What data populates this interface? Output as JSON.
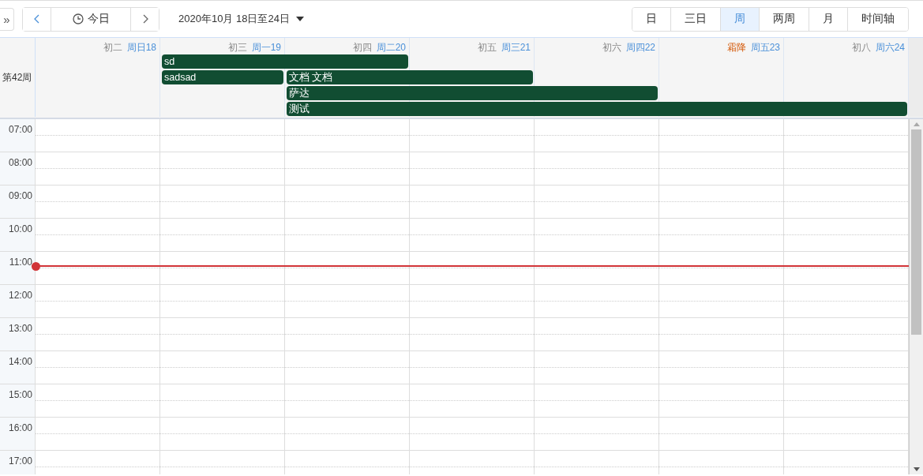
{
  "toolbar": {
    "collapse_icon": "»",
    "today": "今日",
    "range": "2020年10月 18日至24日"
  },
  "views": [
    {
      "label": "日",
      "selected": false
    },
    {
      "label": "三日",
      "selected": false
    },
    {
      "label": "周",
      "selected": true
    },
    {
      "label": "两周",
      "selected": false
    },
    {
      "label": "月",
      "selected": false
    },
    {
      "label": "时间轴",
      "selected": false
    }
  ],
  "week_label": "第42周",
  "days": [
    {
      "lunar": "初二",
      "kind": "lunar",
      "weekday": "周日18"
    },
    {
      "lunar": "初三",
      "kind": "lunar",
      "weekday": "周一19"
    },
    {
      "lunar": "初四",
      "kind": "lunar",
      "weekday": "周二20"
    },
    {
      "lunar": "初五",
      "kind": "lunar",
      "weekday": "周三21"
    },
    {
      "lunar": "初六",
      "kind": "lunar",
      "weekday": "周四22"
    },
    {
      "lunar": "霜降",
      "kind": "solar_term",
      "weekday": "周五23"
    },
    {
      "lunar": "初八",
      "kind": "lunar",
      "weekday": "周六24"
    }
  ],
  "all_day_events": [
    {
      "title": "sd"
    },
    {
      "title": "sadsad"
    },
    {
      "title": "文档 文档"
    },
    {
      "title": "萨达"
    },
    {
      "title": "测试"
    }
  ],
  "hours": [
    "07:00",
    "08:00",
    "09:00",
    "10:00",
    "11:00",
    "12:00",
    "13:00",
    "14:00",
    "15:00",
    "16:00",
    "17:00"
  ]
}
